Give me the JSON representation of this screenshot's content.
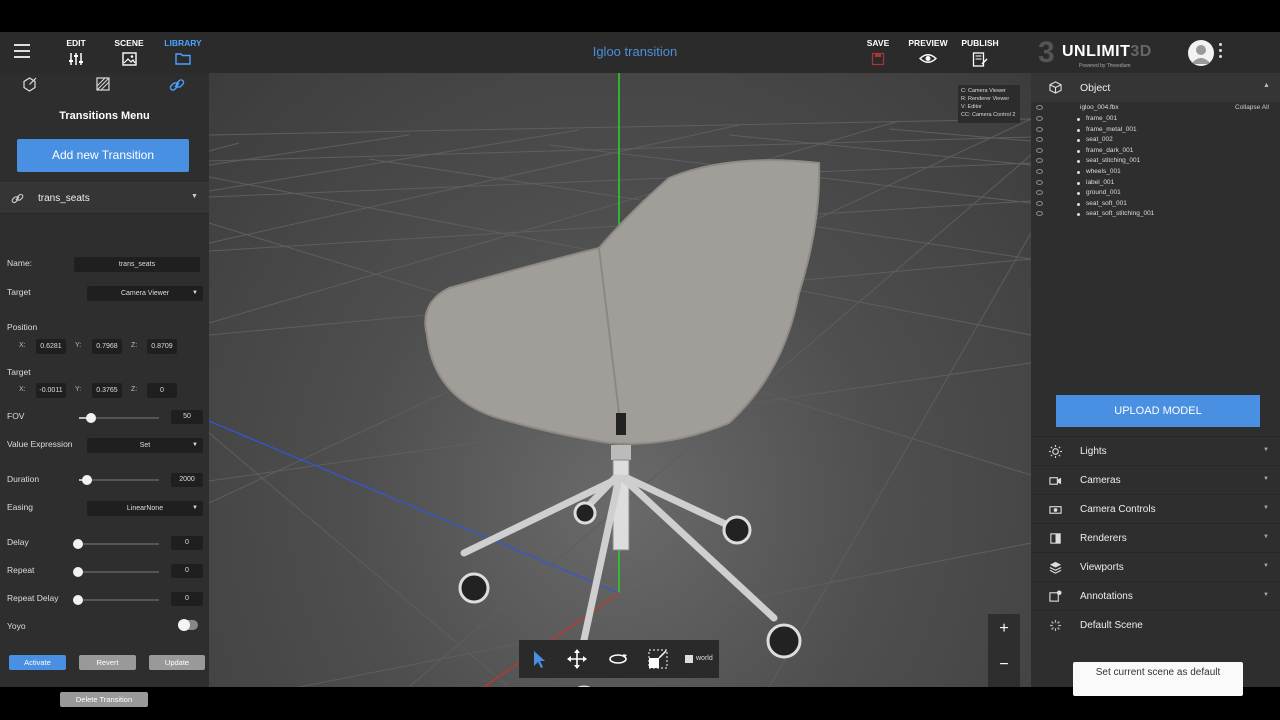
{
  "topbar": {
    "edit_label": "EDIT",
    "scene_label": "SCENE",
    "library_label": "LIBRARY",
    "scene_title": "Igloo transition",
    "save_label": "SAVE",
    "preview_label": "PREVIEW",
    "publish_label": "PUBLISH",
    "logo_mark": "3",
    "logo_word_a": "UNLIMIT",
    "logo_word_b": "3D",
    "logo_sub": "Powered by Threedium"
  },
  "left": {
    "title": "Transitions Menu",
    "add_button": "Add new Transition",
    "transition_name": "trans_seats",
    "name_label": "Name:",
    "name_value": "trans_seats",
    "target_label": "Target",
    "target_value": "Camera Viewer",
    "position_label": "Position",
    "position": {
      "x_label": "X:",
      "x": "0.6281",
      "y_label": "Y:",
      "y": "0.7968",
      "z_label": "Z:",
      "z": "0.8709"
    },
    "target2_label": "Target",
    "target_pos": {
      "x_label": "X:",
      "x": "-0.0011",
      "y_label": "Y:",
      "y": "0.3765",
      "z_label": "Z:",
      "z": "0"
    },
    "fov_label": "FOV",
    "fov_value": "50",
    "fov_level": 0.15,
    "value_expr_label": "Value Expression",
    "value_expr_value": "Set",
    "duration_label": "Duration",
    "duration_value": "2000",
    "duration_level": 0.1,
    "easing_label": "Easing",
    "easing_value": "LinearNone",
    "delay_label": "Delay",
    "delay_value": "0",
    "repeat_label": "Repeat",
    "repeat_value": "0",
    "repeat_delay_label": "Repeat Delay",
    "repeat_delay_value": "0",
    "yoyo_label": "Yoyo",
    "yoyo_on": false,
    "activate": "Activate",
    "revert": "Revert",
    "update": "Update",
    "delete": "Delete Transition"
  },
  "viewport": {
    "hotkeys": [
      "C: Camera Viewer",
      "R: Renderer Viewer",
      "V: Editor",
      "CC: Camera Control 2"
    ],
    "zoom_in": "+",
    "zoom_out": "−",
    "world_label": "world"
  },
  "right": {
    "object_label": "Object",
    "collapse_all": "Collapse All",
    "tree_root": "igloo_004.fbx",
    "tree_items": [
      "frame_001",
      "frame_metal_001",
      "seat_002",
      "frame_dark_001",
      "seat_stitching_001",
      "wheels_001",
      "label_001",
      "ground_001",
      "seat_soft_001",
      "seat_soft_stitching_001"
    ],
    "upload_button": "UPLOAD MODEL",
    "sections": [
      "Lights",
      "Cameras",
      "Camera Controls",
      "Renderers",
      "Viewports",
      "Annotations",
      "Default Scene"
    ],
    "set_default": "Set current scene as default"
  },
  "colors": {
    "accent": "#4a90e2",
    "title_blue": "#4a90d9",
    "panel": "#2e2e2e"
  }
}
